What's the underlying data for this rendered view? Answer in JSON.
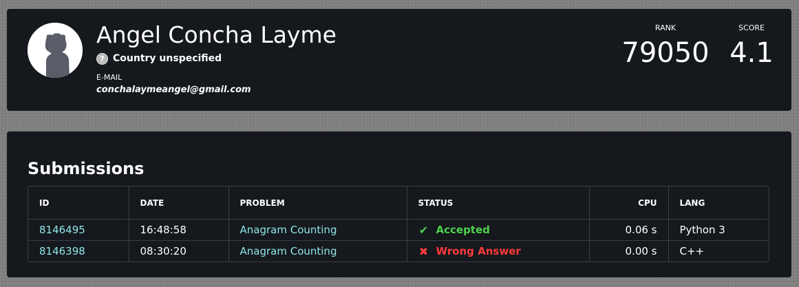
{
  "profile": {
    "avatar_icon": "default-user-avatar",
    "name": "Angel Concha Layme",
    "country_icon": "question-icon",
    "country": "Country unspecified",
    "email_label": "E-MAIL",
    "email": "conchalaymeangel@gmail.com",
    "rank_label": "RANK",
    "rank": "79050",
    "score_label": "SCORE",
    "score": "4.1"
  },
  "submissions": {
    "title": "Submissions",
    "columns": [
      "ID",
      "DATE",
      "PROBLEM",
      "STATUS",
      "CPU",
      "LANG"
    ],
    "rows": [
      {
        "id": "8146495",
        "date": "16:48:58",
        "problem": "Anagram Counting",
        "status_icon": "check-icon",
        "status_symbol": "✔",
        "status": "Accepted",
        "status_color": "#4ed14e",
        "cpu": "0.06 s",
        "lang": "Python 3"
      },
      {
        "id": "8146398",
        "date": "08:30:20",
        "problem": "Anagram Counting",
        "status_icon": "cross-icon",
        "status_symbol": "✖",
        "status": "Wrong Answer",
        "status_color": "#ff3b3b",
        "cpu": "0.00 s",
        "lang": "C++"
      }
    ]
  },
  "colors": {
    "card_bg": "#15181c",
    "link": "#8ee6e8",
    "accepted": "#4ed14e",
    "wrong": "#ff3b3b"
  }
}
